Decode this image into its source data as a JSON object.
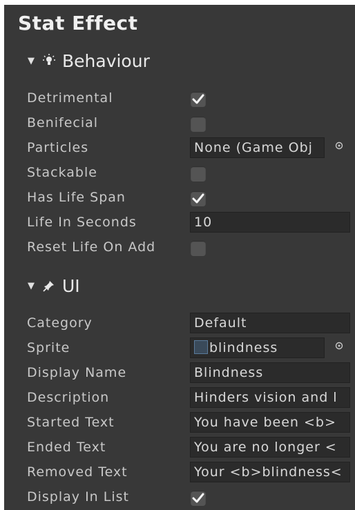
{
  "title": "Stat Effect",
  "behaviour": {
    "header": "Behaviour",
    "icon": "lightbulb-icon",
    "rows": {
      "detrimental": {
        "label": "Detrimental",
        "checked": true
      },
      "benifecial": {
        "label": "Benifecial",
        "checked": false
      },
      "particles": {
        "label": "Particles",
        "value": "None (Game Obj"
      },
      "stackable": {
        "label": "Stackable",
        "checked": false
      },
      "has_life_span": {
        "label": "Has Life Span",
        "checked": true
      },
      "life_in_seconds": {
        "label": "Life In Seconds",
        "value": "10"
      },
      "reset_life_on_add": {
        "label": "Reset Life On Add",
        "checked": false
      }
    }
  },
  "ui": {
    "header": "UI",
    "icon": "pin-icon",
    "rows": {
      "category": {
        "label": "Category",
        "value": "Default"
      },
      "sprite": {
        "label": "Sprite",
        "value": "blindness"
      },
      "display_name": {
        "label": "Display Name",
        "value": "Blindness"
      },
      "description": {
        "label": "Description",
        "value": "Hinders vision and l"
      },
      "started_text": {
        "label": "Started Text",
        "value": "You have been <b>"
      },
      "ended_text": {
        "label": "Ended Text",
        "value": "You are no longer <"
      },
      "removed_text": {
        "label": "Removed Text",
        "value": "Your <b>blindness<"
      },
      "display_in_list": {
        "label": "Display In List",
        "checked": true
      }
    }
  },
  "colors": {
    "panel_bg": "#383838",
    "field_bg": "#2b2b2b",
    "checkbox_bg": "#545454",
    "text": "#c8c8c8"
  }
}
